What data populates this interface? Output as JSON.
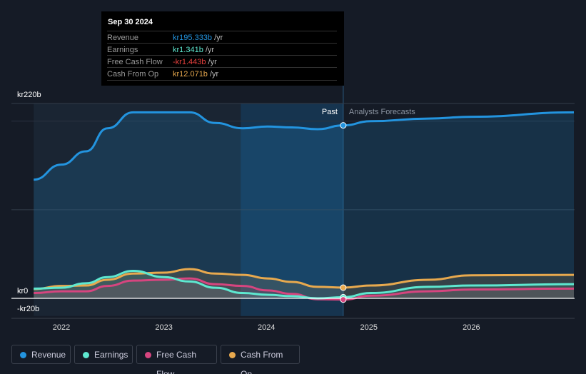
{
  "tooltip": {
    "date": "Sep 30 2024",
    "rows": [
      {
        "label": "Revenue",
        "value": "kr195.333b",
        "unit": " /yr",
        "color": "#2394df"
      },
      {
        "label": "Earnings",
        "value": "kr1.341b",
        "unit": " /yr",
        "color": "#5ee8d0"
      },
      {
        "label": "Free Cash Flow",
        "value": "-kr1.443b",
        "unit": " /yr",
        "color": "#e8413e"
      },
      {
        "label": "Cash From Op",
        "value": "kr12.071b",
        "unit": " /yr",
        "color": "#e8a94e"
      }
    ]
  },
  "labels": {
    "past": "Past",
    "forecast": "Analysts Forecasts"
  },
  "chart_data": {
    "type": "line",
    "ylim": [
      -20,
      220
    ],
    "xlim": [
      2021.6,
      2027.0
    ],
    "ytick_labels": [
      {
        "v": 220,
        "t": "kr220b"
      },
      {
        "v": 0,
        "t": "kr0"
      },
      {
        "v": -20,
        "t": "-kr20b"
      }
    ],
    "xtick_labels": [
      {
        "v": 2022,
        "t": "2022"
      },
      {
        "v": 2023,
        "t": "2023"
      },
      {
        "v": 2024,
        "t": "2024"
      },
      {
        "v": 2025,
        "t": "2025"
      },
      {
        "v": 2026,
        "t": "2026"
      }
    ],
    "past_end": 2024.75,
    "highlight_start": 2023.75,
    "x": [
      2021.73,
      2022.0,
      2022.24,
      2022.45,
      2022.7,
      2023.0,
      2023.25,
      2023.5,
      2023.77,
      2024.01,
      2024.25,
      2024.5,
      2024.75,
      2025.02,
      2025.58,
      2026.0,
      2027.0
    ],
    "series": [
      {
        "name": "Revenue",
        "color": "#2394df",
        "values": [
          134,
          151,
          166,
          192,
          210,
          210,
          210,
          198,
          192,
          194,
          193,
          191,
          195.3,
          200,
          203,
          205,
          210
        ]
      },
      {
        "name": "Earnings",
        "color": "#5ee8d0",
        "values": [
          11,
          12,
          17,
          24,
          31,
          24,
          19,
          12,
          6,
          4,
          2.5,
          0,
          1.3,
          6,
          13,
          14.5,
          16
        ]
      },
      {
        "name": "Free Cash Flow",
        "color": "#d6457f",
        "values": [
          6,
          8,
          8,
          14,
          20,
          21,
          22.5,
          16,
          14,
          9,
          5,
          -1,
          -1.4,
          3,
          8,
          10,
          11
        ]
      },
      {
        "name": "Cash From Op",
        "color": "#e8a94e",
        "values": [
          10.5,
          14,
          14.5,
          21,
          28,
          29,
          33,
          28,
          26.5,
          22.5,
          18.5,
          13,
          12.1,
          14.5,
          21,
          26,
          26.5
        ]
      }
    ]
  }
}
